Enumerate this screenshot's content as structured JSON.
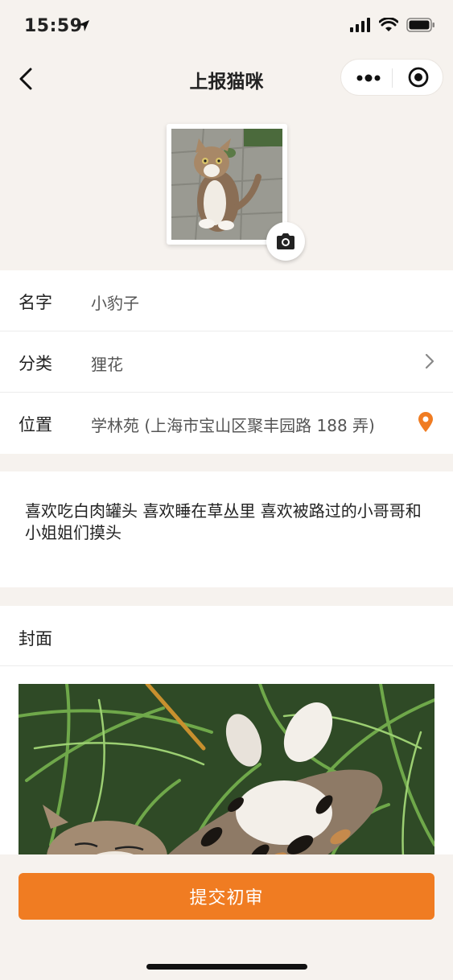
{
  "status": {
    "time": "15:59"
  },
  "nav": {
    "title": "上报猫咪"
  },
  "form": {
    "name": {
      "label": "名字",
      "value": "小豹子"
    },
    "category": {
      "label": "分类",
      "value": "狸花"
    },
    "location": {
      "label": "位置",
      "value": "学林苑 (上海市宝山区聚丰园路 188 弄)"
    }
  },
  "description": "喜欢吃白肉罐头 喜欢睡在草丛里 喜欢被路过的小哥哥和小姐姐们摸头",
  "cover": {
    "title": "封面"
  },
  "submit_label": "提交初审",
  "colors": {
    "accent": "#f07c22",
    "page_bg": "#f6f2ee",
    "card_bg": "#ffffff"
  }
}
